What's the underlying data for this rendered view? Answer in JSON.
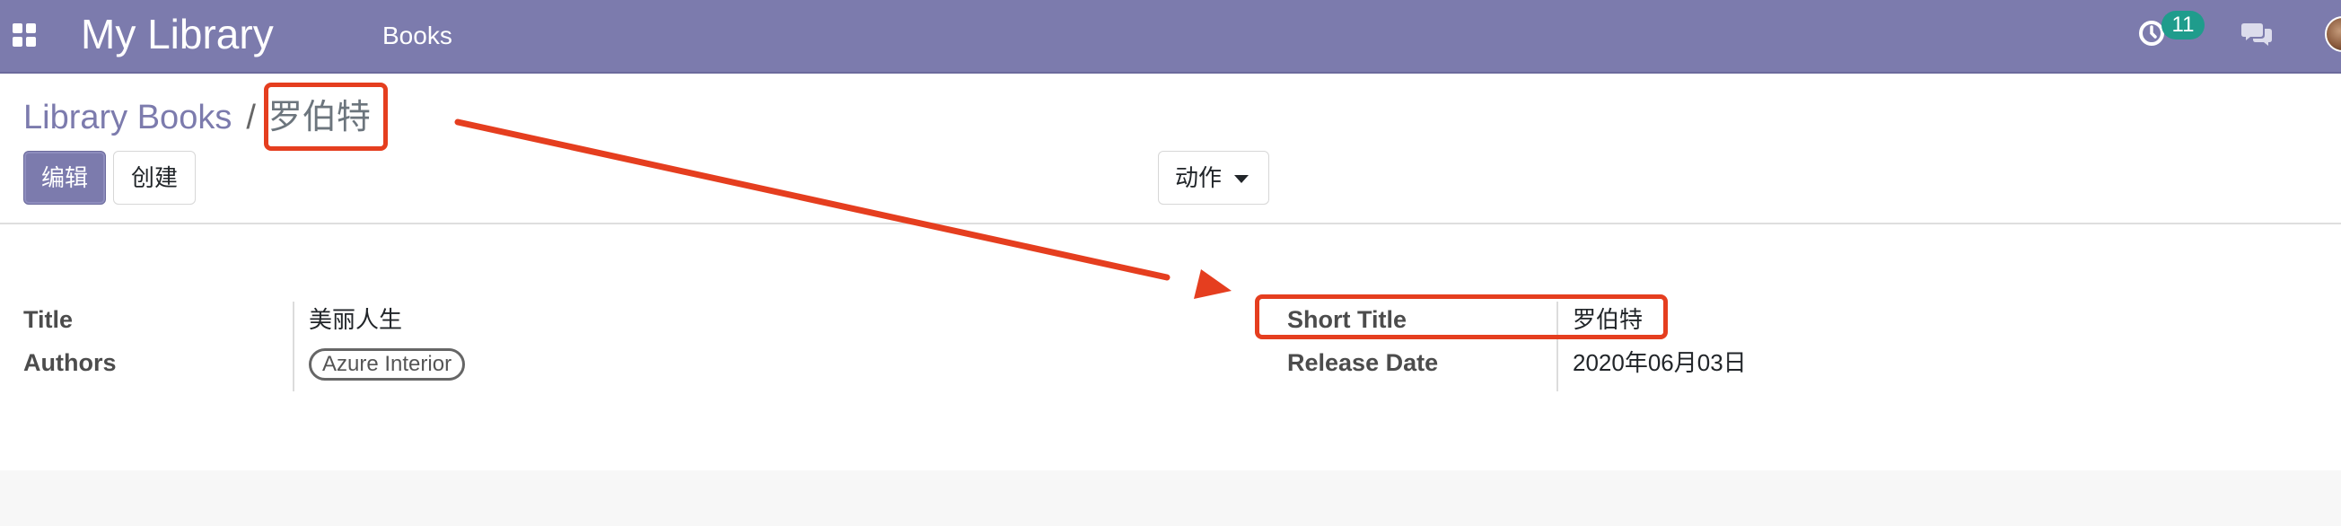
{
  "navbar": {
    "apps_icon": "apps-grid-icon",
    "app_title": "My Library",
    "menu": [
      "Books"
    ],
    "activity_icon": "clock-icon",
    "activity_count": "11",
    "chat_icon": "chat-bubbles-icon",
    "avatar": "user-avatar"
  },
  "breadcrumb": {
    "parent": "Library Books",
    "separator": "/",
    "current": "罗伯特"
  },
  "buttons": {
    "edit": "编辑",
    "create": "创建",
    "action": "动作"
  },
  "form": {
    "left": {
      "title_label": "Title",
      "title_value": "美丽人生",
      "authors_label": "Authors",
      "authors_tags": [
        "Azure Interior"
      ]
    },
    "right": {
      "short_title_label": "Short Title",
      "short_title_value": "罗伯特",
      "release_date_label": "Release Date",
      "release_date_value": "2020年06月03日"
    }
  },
  "colors": {
    "navbar": "#7c7bad",
    "primary": "#7c7bad",
    "badge": "#1f9c8c",
    "annotation": "#e53e1f"
  }
}
